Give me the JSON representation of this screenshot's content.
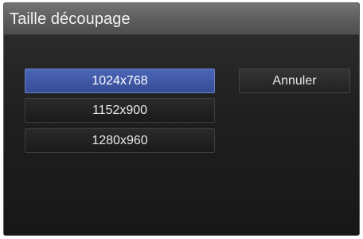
{
  "dialog": {
    "title": "Taille découpage"
  },
  "options": [
    {
      "label": "1024x768",
      "selected": true
    },
    {
      "label": "1152x900",
      "selected": false
    },
    {
      "label": "1280x960",
      "selected": false
    }
  ],
  "buttons": {
    "cancel_label": "Annuler"
  },
  "colors": {
    "selection": "#4259a8",
    "background": "#1e1e1e",
    "titlebar": "#5e5e5e"
  }
}
